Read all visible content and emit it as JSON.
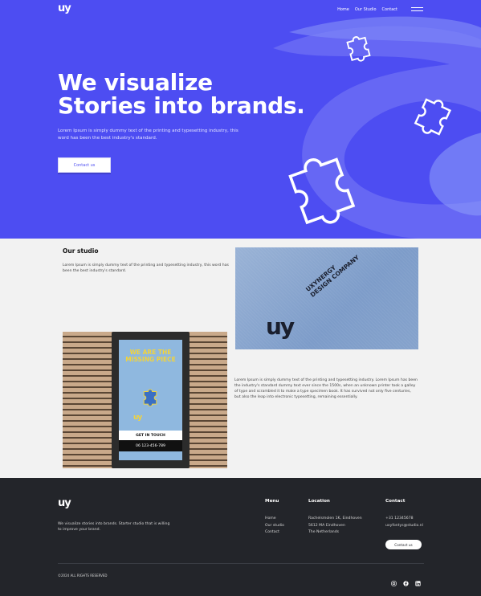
{
  "brand": {
    "logo": "uy"
  },
  "nav": {
    "items": [
      "Home",
      "Our Studio",
      "Contact"
    ]
  },
  "hero": {
    "headline_line1": "We visualize",
    "headline_line2": "Stories into brands.",
    "subtext": "Lorem Ipsum is simply dummy text of the printing and typesetting industry, this word has been the best industry's standard.",
    "button_label": "Contact us"
  },
  "studio": {
    "title": "Our studio",
    "text1": "Lorem Ipsum is simply dummy text of the printing and typesetting industry, this word has been the best industry's standard.",
    "text2": "Lorem Ipsum is simply dummy text of the printing and typesetting industry. Lorem Ipsum has been the industry's standard dummy text ever since the 1500s, when an unknown printer took a galley of type and scrambled it to make a type specimen book. It has survived not only five centuries, but also the leap into electronic typesetting, remaining essentially.",
    "board_logo": "uy",
    "board_caption_line1": "UXYNERGY",
    "board_caption_line2": "DESIGN COMPANY",
    "poster_title": "WE ARE THE MISSING PIECE",
    "poster_logo": "uy",
    "poster_cta": "GET IN TOUCH",
    "poster_phone": "06 123-456-789"
  },
  "footer": {
    "logo": "uy",
    "tagline": "We visualize stories into brands. Starter studio that is willing to improve your brand.",
    "menu_title": "Menu",
    "menu_items": [
      "Home",
      "Our studio",
      "Contact"
    ],
    "location_title": "Location",
    "location_lines": [
      "Rachelsmolen 1K, Eindhoven",
      "5612 MA Eindhoven",
      "The Netherlands"
    ],
    "contact_title": "Contact",
    "contact_lines": [
      "+31 12345678",
      "uxyfontys@studio.nl"
    ],
    "contact_button": "Contact us",
    "rights": "©2024 ALL RIGHTS RESERVED",
    "social_icons": [
      "instagram-icon",
      "facebook-icon",
      "linkedin-icon"
    ]
  },
  "colors": {
    "hero_bg": "#4d4df2",
    "footer_bg": "#23252a",
    "page_bg": "#f2f2f2"
  }
}
